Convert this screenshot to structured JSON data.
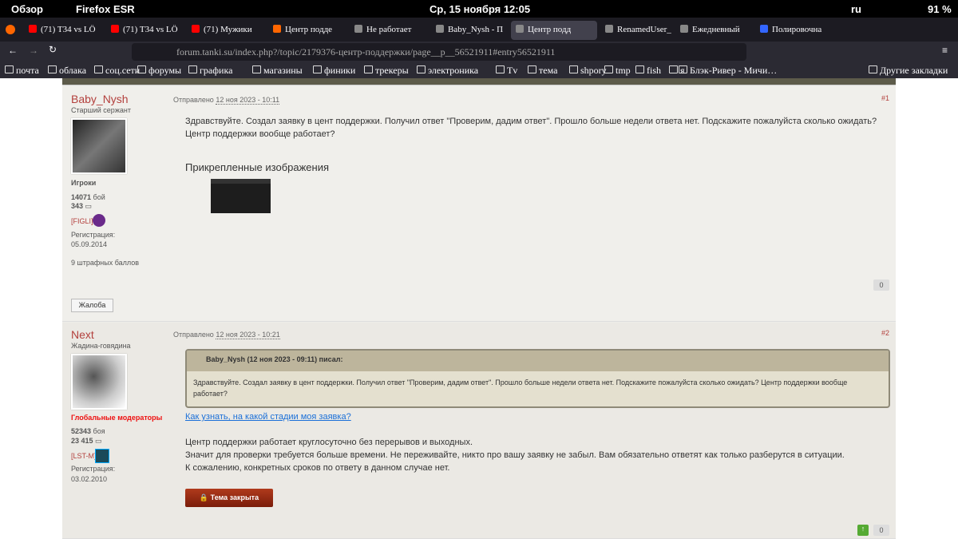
{
  "system": {
    "overview": "Обзор",
    "app": "Firefox ESR",
    "clock": "Ср, 15 ноября 12:05",
    "lang": "ru",
    "battery": "91 %"
  },
  "tabs": [
    {
      "label": "(71) T34 vs LÖ",
      "color": "#f00"
    },
    {
      "label": "(71) T34 vs LÖ",
      "color": "#f00"
    },
    {
      "label": "(71) Мужики",
      "color": "#f00"
    },
    {
      "label": "Центр подде",
      "color": "#f60"
    },
    {
      "label": "Не работает",
      "color": "#888"
    },
    {
      "label": "Baby_Nysh - П",
      "color": "#888"
    },
    {
      "label": "Центр подд",
      "color": "#888",
      "active": true
    },
    {
      "label": "RenamedUser_",
      "color": "#888"
    },
    {
      "label": "Ежедневный",
      "color": "#888"
    },
    {
      "label": "Полировочна",
      "color": "#36f"
    }
  ],
  "url": "forum.tanki.su/index.php?/topic/2179376-центр-поддержки/page__p__56521911#entry56521911",
  "bookmarks": [
    "почта",
    "облака",
    "соц.сети",
    "форумы",
    "графика",
    "магазины",
    "финики",
    "трекеры",
    "электроника",
    "Tv",
    "тема",
    "shpory",
    "tmp",
    "fish",
    "я",
    "Блэк-Ривер - Мичи…"
  ],
  "other_bookmarks": "Другие закладки",
  "posts": [
    {
      "author": "Baby_Nysh",
      "rank": "Старший сержант",
      "group": "Игроки",
      "battles": "14071",
      "battles_label": "бой",
      "messages": "343",
      "clan": "[FIGLI]",
      "reg_label": "Регистрация:",
      "reg": "05.09.2014",
      "penalty": "9 штрафных баллов",
      "posted": "Отправлено",
      "date": "12 ноя 2023 - 10:11",
      "num": "#1",
      "text": "Здравствуйте. Создал заявку в цент поддержки. Получил ответ \"Проверим, дадим ответ\". Прошло больше недели ответа нет. Подскажите пожалуйста сколько ожидать? Центр поддержки вообще работает?",
      "attach_title": "Прикрепленные изображения",
      "rep": "0",
      "report": "Жалоба"
    },
    {
      "author": "Next",
      "rank": "Жадина-говядина",
      "group": "Глобальные модераторы",
      "battles": "52343",
      "battles_label": "боя",
      "messages": "23 415",
      "clan": "[LST-M]",
      "reg_label": "Регистрация:",
      "reg": "03.02.2010",
      "posted": "Отправлено",
      "date": "12 ноя 2023 - 10:21",
      "num": "#2",
      "quote_head": "Baby_Nysh (12 ноя 2023 - 09:11) писал:",
      "quote": "Здравствуйте. Создал заявку в цент поддержки. Получил ответ \"Проверим, дадим ответ\". Прошло больше недели ответа нет. Подскажите пожалуйста сколько ожидать? Центр поддержки вообще работает?",
      "link": "Как узнать, на какой стадии моя заявка?",
      "lines": [
        "Центр поддержки работает круглосуточно без перерывов и выходных.",
        "Значит для проверки требуется больше времени. Не переживайте, никто про вашу заявку не забыл. Вам обязательно ответят как только разберутся в ситуации.",
        "К сожалению, конкретных сроков по ответу в данном случае нет."
      ],
      "closed": "Тема закрыта",
      "rep": "0"
    }
  ]
}
